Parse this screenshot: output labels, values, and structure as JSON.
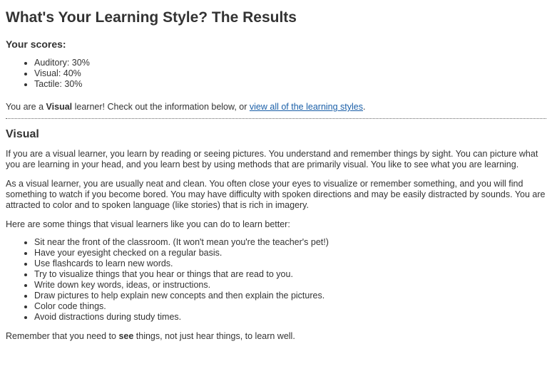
{
  "title": "What's Your Learning Style? The Results",
  "scores": {
    "heading": "Your scores:",
    "items": [
      "Auditory: 30%",
      "Visual: 40%",
      "Tactile: 30%"
    ]
  },
  "result": {
    "prefix": "You are a ",
    "style": "Visual",
    "middle": " learner! Check out the information below, or ",
    "link_text": "view all of the learning styles",
    "suffix": "."
  },
  "section": {
    "heading": "Visual",
    "paragraph1": "If you are a visual learner, you learn by reading or seeing pictures. You understand and remember things by sight. You can picture what you are learning in your head, and you learn best by using methods that are primarily visual. You like to see what you are learning.",
    "paragraph2": "As a visual learner, you are usually neat and clean. You often close your eyes to visualize or remember something, and you will find something to watch if you become bored. You may have difficulty with spoken directions and may be easily distracted by sounds. You are attracted to color and to spoken language (like stories) that is rich in imagery.",
    "paragraph3": "Here are some things that visual learners like you can do to learn better:",
    "tips": [
      "Sit near the front of the classroom. (It won't mean you're the teacher's pet!)",
      "Have your eyesight checked on a regular basis.",
      "Use flashcards to learn new words.",
      "Try to visualize things that you hear or things that are read to you.",
      "Write down key words, ideas, or instructions.",
      "Draw pictures to help explain new concepts and then explain the pictures.",
      "Color code things.",
      "Avoid distractions during study times."
    ],
    "closing": {
      "prefix": "Remember that you need to ",
      "emphasis": "see",
      "suffix": " things, not just hear things, to learn well."
    }
  },
  "colors": {
    "text": "#333333",
    "link": "#1a5fa8",
    "background": "#ffffff"
  }
}
